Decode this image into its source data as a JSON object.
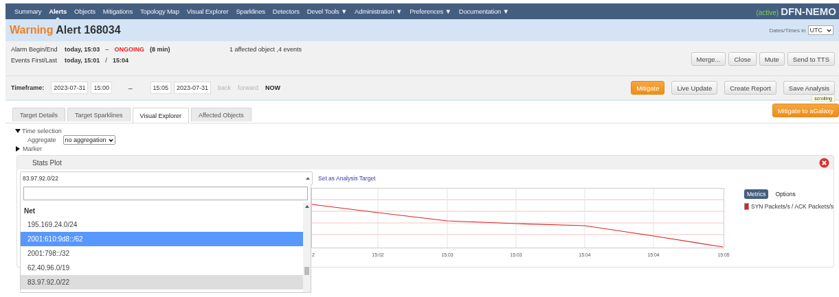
{
  "nav": {
    "items": [
      {
        "label": "Summary",
        "selected": false
      },
      {
        "label": "Alerts",
        "selected": true
      },
      {
        "label": "Objects",
        "selected": false
      },
      {
        "label": "Mitigations",
        "selected": false
      },
      {
        "label": "Topology Map",
        "selected": false
      },
      {
        "label": "Visual Explorer",
        "selected": false
      },
      {
        "label": "Sparklines",
        "selected": false
      },
      {
        "label": "Detectors",
        "selected": false
      },
      {
        "label": "Devel Tools ▼",
        "selected": false
      },
      {
        "label": "Administration ▼",
        "selected": false
      },
      {
        "label": "Preferences ▼",
        "selected": false
      },
      {
        "label": "Documentation ▼",
        "selected": false
      }
    ],
    "brand_status": "(active)",
    "brand": "DFN-NEMO"
  },
  "header": {
    "severity": "Warning",
    "title": "Alert 168034",
    "tz_label": "Dates/Times in",
    "tz_value": "UTC"
  },
  "info": {
    "rows": [
      {
        "label": "Alarm Begin/End",
        "begin": "today, 15:03",
        "separator": "–",
        "end": "ONGOING",
        "end_alert": true,
        "duration": "(8 min)"
      },
      {
        "label": "Events First/Last",
        "begin": "today, 15:01",
        "separator": "/",
        "end": "15:04",
        "end_alert": false
      }
    ],
    "summary": "1 affected object ,4 events",
    "actions": [
      "Merge...",
      "Close",
      "Mute",
      "Send to TTS"
    ]
  },
  "timeframe": {
    "label": "Timeframe:",
    "from_date": "2023-07-31",
    "from_time": "15:00",
    "dash": "–",
    "to_time": "15:05",
    "to_date": "2023-07-31",
    "links": [
      {
        "label": "back",
        "disabled": true
      },
      {
        "label": "forward",
        "disabled": true
      },
      {
        "label": "NOW",
        "disabled": false
      }
    ],
    "buttons": [
      {
        "label": "Mitigate",
        "kind": "primary"
      },
      {
        "label": "Live Update",
        "kind": "default"
      },
      {
        "label": "Create Report",
        "kind": "default"
      },
      {
        "label": "Save Analysis",
        "kind": "default"
      }
    ],
    "tooltip": "scrolling"
  },
  "mitigate_button": "Mitigate to aGalaxy",
  "tabs": [
    {
      "label": "Target Details",
      "selected": false
    },
    {
      "label": "Target Sparklines",
      "selected": false
    },
    {
      "label": "Visual Explorer",
      "selected": true
    },
    {
      "label": "Affected Objects",
      "selected": false
    }
  ],
  "time_selection": {
    "label": "Time selection",
    "expanded": true,
    "aggregate_label": "Aggregate",
    "aggregate_value": "no aggregation"
  },
  "marker": {
    "label": "Marker",
    "expanded": false
  },
  "stats_plot": {
    "title": "Stats Plot",
    "select_value": "83.97.92.0/22",
    "link": "Set as Analysis Target",
    "dropdown": {
      "group": "Net",
      "options": [
        {
          "label": "195.169.24.0/24",
          "highlighted": false,
          "selected": false
        },
        {
          "label": "2001:610:9d8::/62",
          "highlighted": true,
          "selected": false
        },
        {
          "label": "2001:798::/32",
          "highlighted": false,
          "selected": false
        },
        {
          "label": "62.40.96.0/19",
          "highlighted": false,
          "selected": false
        },
        {
          "label": "83.97.92.0/22",
          "highlighted": false,
          "selected": true
        }
      ]
    },
    "x_labels": [
      "2",
      "15:02",
      "15:03",
      "15:03",
      "15:04",
      "15:04",
      "15:05"
    ],
    "legend_tabs": [
      {
        "label": "Metrics",
        "selected": true
      },
      {
        "label": "Options",
        "selected": false
      }
    ],
    "series": [
      {
        "name": "SYN Packets/s / ACK Packets/s",
        "color": "#e02020"
      }
    ]
  }
}
